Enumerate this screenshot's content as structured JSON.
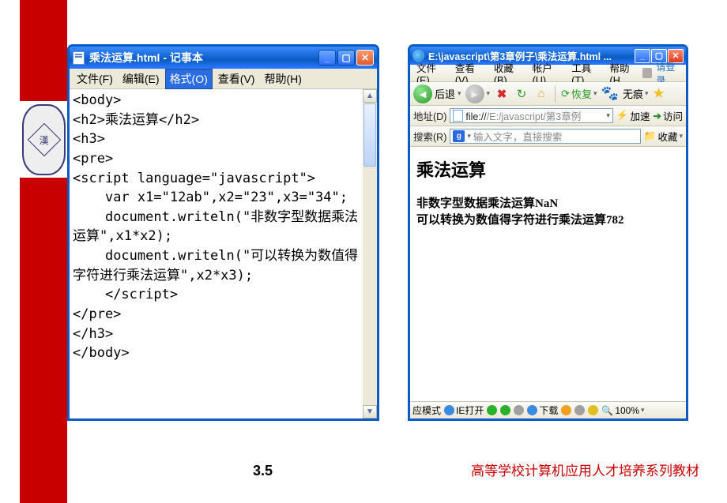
{
  "notepad": {
    "title": "乘法运算.html - 记事本",
    "menu": {
      "file": "文件(F)",
      "edit": "编辑(E)",
      "format": "格式(O)",
      "view": "查看(V)",
      "help": "帮助(H)"
    },
    "code": "<body>\n<h2>乘法运算</h2>\n<h3>\n<pre>\n<script language=\"javascript\">\n    var x1=\"12ab\",x2=\"23\",x3=\"34\";\n    document.writeln(\"非数字型数据乘法运算\",x1*x2);\n    document.writeln(\"可以转换为数值得字符进行乘法运算\",x2*x3);\n    </script>\n</pre>\n</h3>\n</body>"
  },
  "browser": {
    "title": "E:\\javascript\\第3章例子\\乘法运算.html ...",
    "menu": {
      "file": "文件(E)",
      "view": "查看(V)",
      "fav": "收藏(B)",
      "account": "帐户(U)",
      "tools": "工具(T)",
      "help": "帮助(H",
      "login": "请登录"
    },
    "toolbar": {
      "back": "后退",
      "restore": "恢复",
      "notrace": "无痕"
    },
    "address": {
      "label": "地址(D)",
      "prefix": "file://",
      "path": "/E:/javascript/第3章例",
      "accel": "加速",
      "go": "访问"
    },
    "search": {
      "label": "搜索(R)",
      "placeholder": "输入文字，直接搜索",
      "fav": "收藏"
    },
    "content": {
      "heading": "乘法运算",
      "line1": "非数字型数据乘法运算NaN",
      "line2": "可以转换为数值得字符进行乘法运算782"
    },
    "status": {
      "mode": "应模式",
      "ie": "IE打开",
      "download": "下载",
      "zoom": "100%"
    }
  },
  "footer": {
    "left": "3.5",
    "right": "高等学校计算机应用人才培养系列教材"
  }
}
